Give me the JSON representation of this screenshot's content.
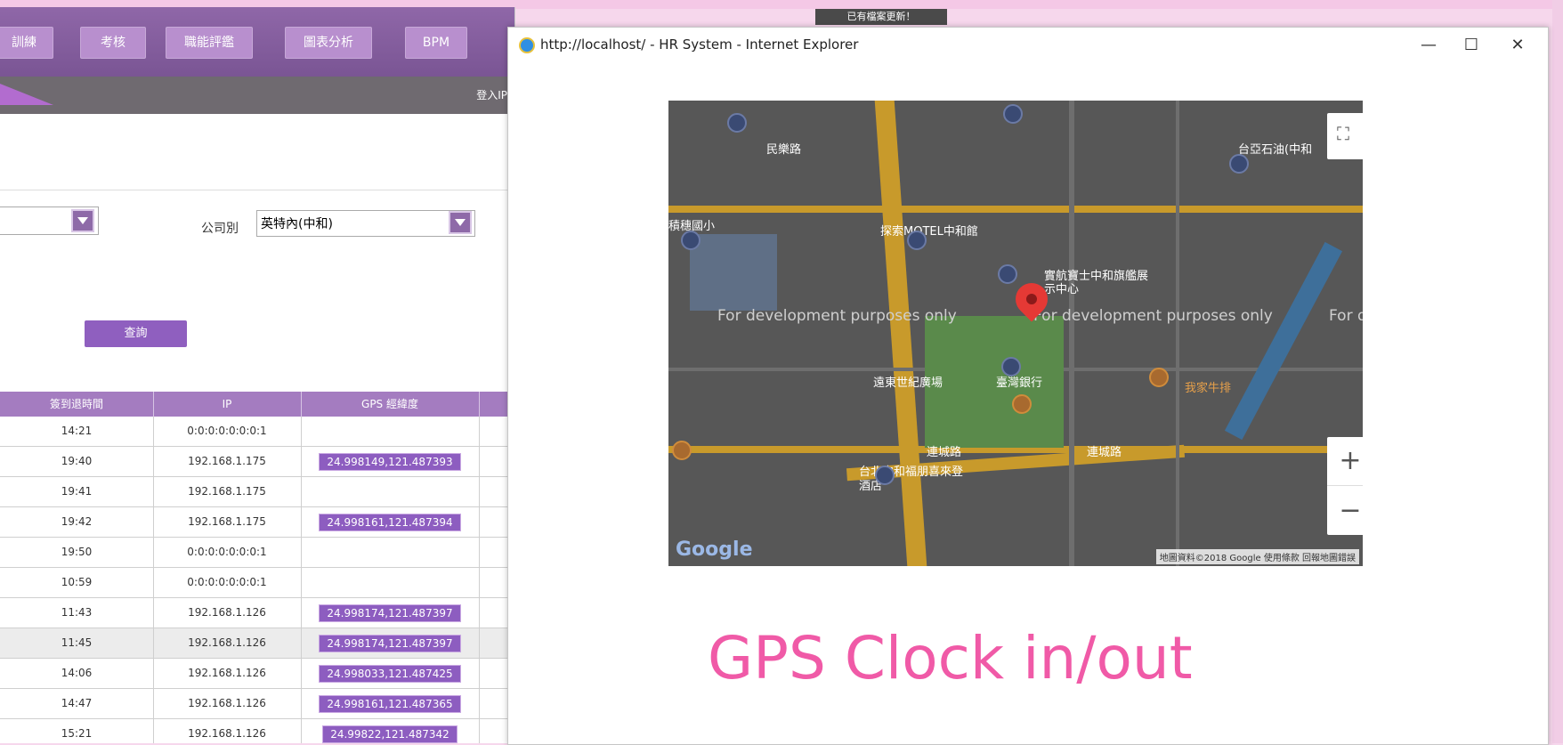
{
  "background_app": {
    "nav_items": [
      "訓練",
      "考核",
      "職能評鑑",
      "圖表分析",
      "BPM"
    ],
    "login_ip_label": "登入IP",
    "update_notice": "已有檔案更新！",
    "company_label": "公司別",
    "company_value": "英特內(中和)",
    "query_button": "查詢",
    "table": {
      "columns": [
        "簽到退時間",
        "IP",
        "GPS 經緯度"
      ],
      "rows": [
        {
          "time": "14:21",
          "ip": "0:0:0:0:0:0:0:1",
          "gps": ""
        },
        {
          "time": "19:40",
          "ip": "192.168.1.175",
          "gps": "24.998149,121.487393"
        },
        {
          "time": "19:41",
          "ip": "192.168.1.175",
          "gps": ""
        },
        {
          "time": "19:42",
          "ip": "192.168.1.175",
          "gps": "24.998161,121.487394"
        },
        {
          "time": "19:50",
          "ip": "0:0:0:0:0:0:0:1",
          "gps": ""
        },
        {
          "time": "10:59",
          "ip": "0:0:0:0:0:0:0:1",
          "gps": ""
        },
        {
          "time": "11:43",
          "ip": "192.168.1.126",
          "gps": "24.998174,121.487397"
        },
        {
          "time": "11:45",
          "ip": "192.168.1.126",
          "gps": "24.998174,121.487397"
        },
        {
          "time": "14:06",
          "ip": "192.168.1.126",
          "gps": "24.998033,121.487425"
        },
        {
          "time": "14:47",
          "ip": "192.168.1.126",
          "gps": "24.998161,121.487365"
        },
        {
          "time": "15:21",
          "ip": "192.168.1.126",
          "gps": "24.99822,121.487342"
        }
      ]
    }
  },
  "ie_window": {
    "title": "http://localhost/ - HR System - Internet Explorer",
    "controls": {
      "minimize": "—",
      "maximize": "☐",
      "close": "✕"
    }
  },
  "map": {
    "dev_text": "For development purposes only",
    "dev_text_partial": "For dev",
    "labels": {
      "street_1": "民樂路",
      "motel": "探索MOTEL中和館",
      "school": "積穗國小",
      "store": "實航寶士中和旗艦展示中心",
      "plaza": "遠東世紀廣場",
      "bank": "臺灣銀行",
      "steak": "我家牛排",
      "road_1": "連城路",
      "road_2": "連城路",
      "hotel": "台北中和福朋喜來登酒店",
      "gas": "台亞石油(中和"
    },
    "zoom_in": "+",
    "zoom_out": "−",
    "fullscreen_icon": "fullscreen-icon",
    "logo": "Google",
    "attribution": "地圖資料©2018 Google  使用條款  回報地圖錯誤"
  },
  "overlay_heading": "GPS Clock in/out",
  "colors": {
    "accent": "#8d5dc0",
    "heading": "#f05aa7",
    "nav": "#7a5594"
  }
}
